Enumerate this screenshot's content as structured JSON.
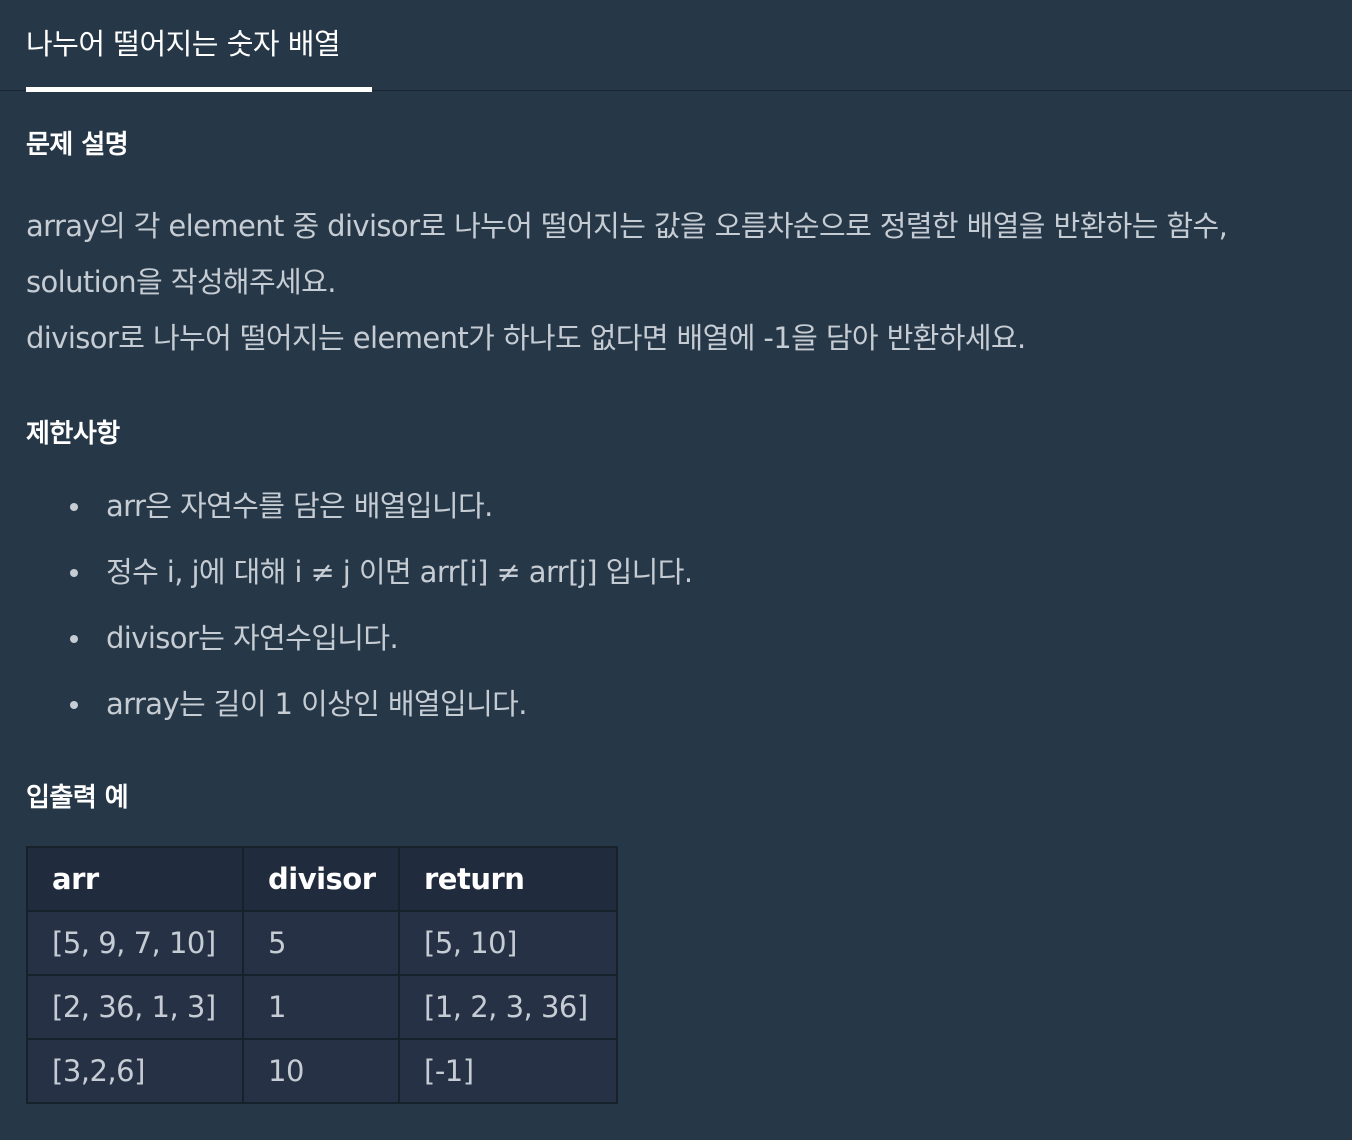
{
  "tab": {
    "title": "나누어 떨어지는 숫자 배열"
  },
  "description": {
    "heading": "문제 설명",
    "lines": [
      "array의 각 element 중 divisor로 나누어 떨어지는 값을 오름차순으로 정렬한 배열을 반환하는 함수,",
      "solution을 작성해주세요.",
      "divisor로 나누어 떨어지는 element가 하나도 없다면 배열에 -1을 담아 반환하세요."
    ]
  },
  "constraints": {
    "heading": "제한사항",
    "items": [
      "arr은 자연수를 담은 배열입니다.",
      "정수 i, j에 대해 i ≠ j 이면 arr[i] ≠ arr[j] 입니다.",
      "divisor는 자연수입니다.",
      "array는 길이 1 이상인 배열입니다."
    ]
  },
  "examples": {
    "heading": "입출력 예",
    "columns": [
      "arr",
      "divisor",
      "return"
    ],
    "rows": [
      [
        "[5, 9, 7, 10]",
        "5",
        "[5, 10]"
      ],
      [
        "[2, 36, 1, 3]",
        "1",
        "[1, 2, 3, 36]"
      ],
      [
        "[3,2,6]",
        "10",
        "[-1]"
      ]
    ]
  }
}
